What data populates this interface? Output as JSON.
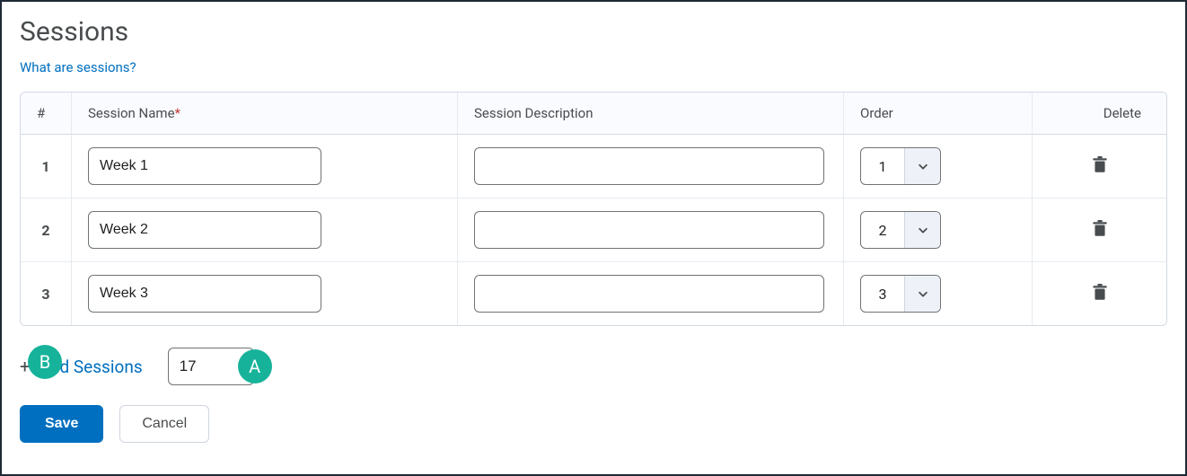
{
  "title": "Sessions",
  "helpLink": "What are sessions?",
  "columns": {
    "num": "#",
    "name": "Session Name",
    "nameReq": "*",
    "desc": "Session Description",
    "order": "Order",
    "delete": "Delete"
  },
  "rows": [
    {
      "index": "1",
      "name": "Week 1",
      "desc": "",
      "order": "1"
    },
    {
      "index": "2",
      "name": "Week 2",
      "desc": "",
      "order": "2"
    },
    {
      "index": "3",
      "name": "Week 3",
      "desc": "",
      "order": "3"
    }
  ],
  "addRow": {
    "plus": "+",
    "label": "Add Sessions",
    "count": "17"
  },
  "buttons": {
    "save": "Save",
    "cancel": "Cancel"
  },
  "callouts": {
    "a": "A",
    "b": "B"
  }
}
